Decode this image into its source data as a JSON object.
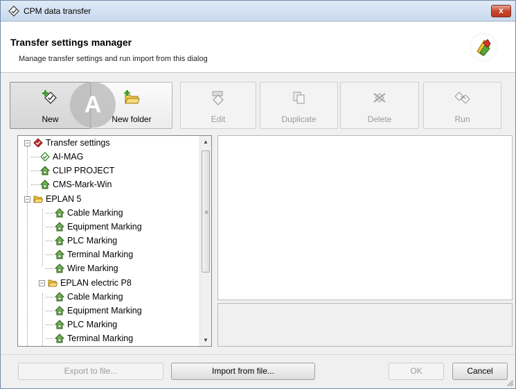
{
  "window": {
    "title": "CPM data transfer",
    "close_label": "x"
  },
  "header": {
    "title": "Transfer settings manager",
    "subtitle": "Manage transfer settings and run import from this dialog"
  },
  "toolbar": {
    "new_label": "New",
    "new_folder_label": "New folder",
    "edit_label": "Edit",
    "duplicate_label": "Duplicate",
    "delete_label": "Delete",
    "run_label": "Run"
  },
  "marker": {
    "label": "A"
  },
  "tree": {
    "root": "Transfer settings",
    "ai_mag": "AI-MAG",
    "clip_project": "CLIP PROJECT",
    "cms_mark_win": "CMS-Mark-Win",
    "eplan5": {
      "label": "EPLAN 5",
      "items": [
        "Cable Marking",
        "Equipment Marking",
        "PLC Marking",
        "Terminal Marking",
        "Wire Marking"
      ]
    },
    "eplan_p8": {
      "label": "EPLAN electric P8",
      "items": [
        "Cable Marking",
        "Equipment Marking",
        "PLC Marking",
        "Terminal Marking"
      ]
    }
  },
  "footer": {
    "export_label": "Export to file...",
    "import_label": "Import from file...",
    "ok_label": "OK",
    "cancel_label": "Cancel"
  },
  "colors": {
    "accent_green": "#4a9a2e",
    "folder_yellow": "#f2c12e",
    "root_red": "#c8292e",
    "titlebar": "#c9daee"
  }
}
